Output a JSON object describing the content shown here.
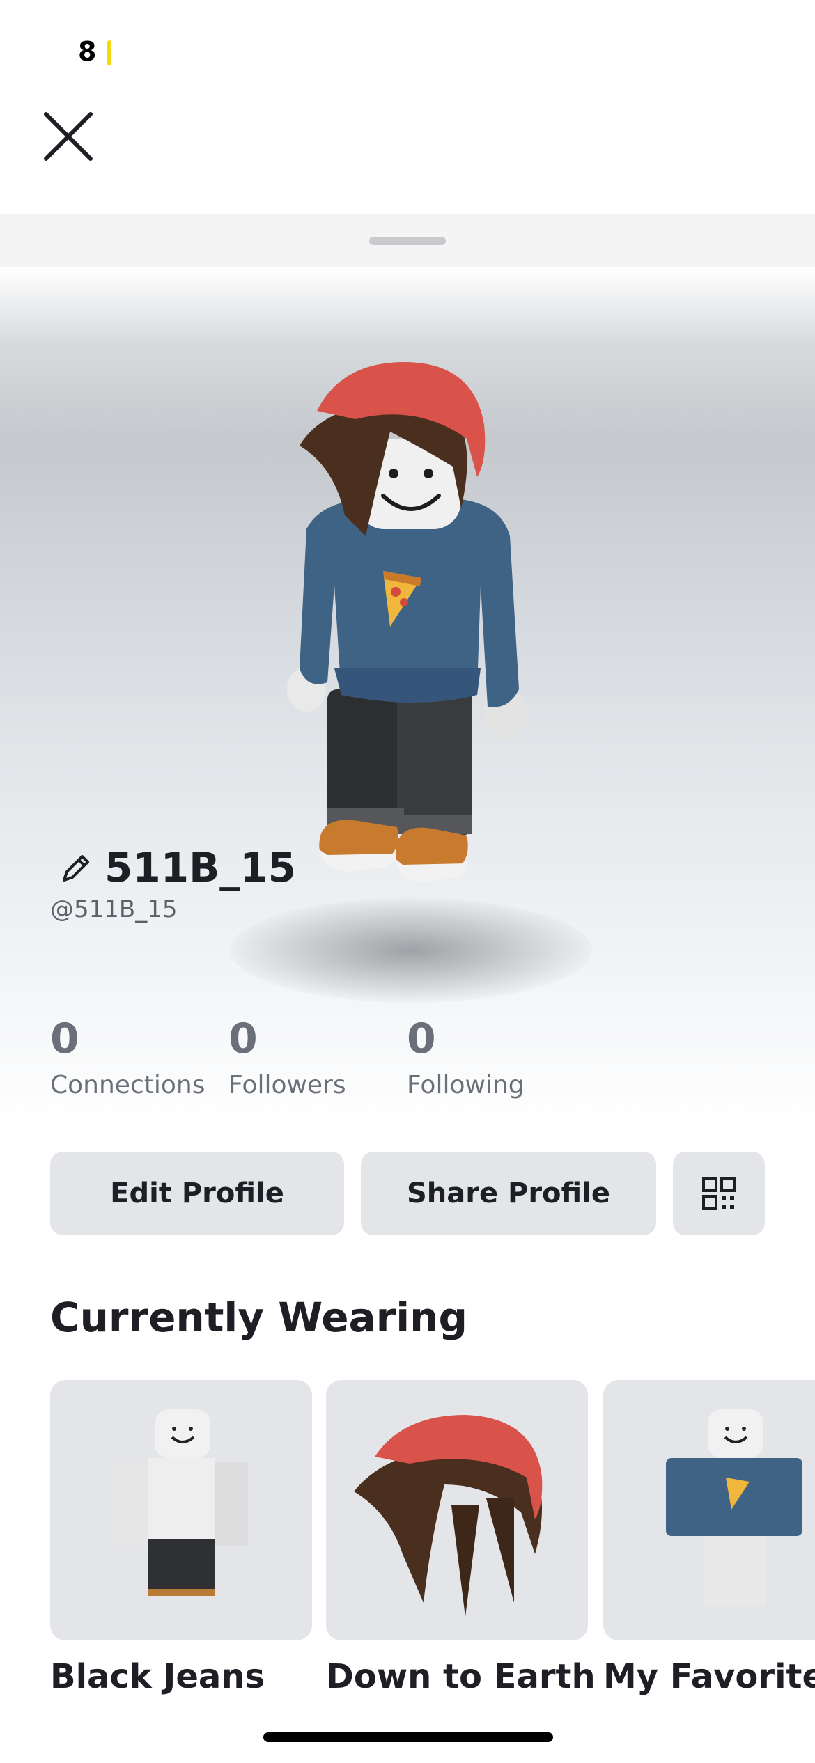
{
  "status_bar": {
    "time": "8"
  },
  "close": {
    "icon": "close-icon"
  },
  "profile": {
    "display_name": "511B_15",
    "username": "@511B_15",
    "edit_icon": "pencil-icon"
  },
  "stats": [
    {
      "count": "0",
      "label": "Connections"
    },
    {
      "count": "0",
      "label": "Followers"
    },
    {
      "count": "0",
      "label": "Following"
    }
  ],
  "actions": {
    "edit_profile": "Edit Profile",
    "share_profile": "Share Profile",
    "qr_icon": "qr-code-icon"
  },
  "currently_wearing": {
    "title": "Currently Wearing",
    "items": [
      {
        "name": "Black Jeans"
      },
      {
        "name": "Down to Earth"
      },
      {
        "name": "My Favorite"
      }
    ]
  },
  "colors": {
    "status_indicator": "#f5d90a",
    "button_bg": "#e4e5e9",
    "stat_text": "#6b6f7a",
    "beanie_red": "#d9534a",
    "sweater_blue": "#3f6385"
  }
}
